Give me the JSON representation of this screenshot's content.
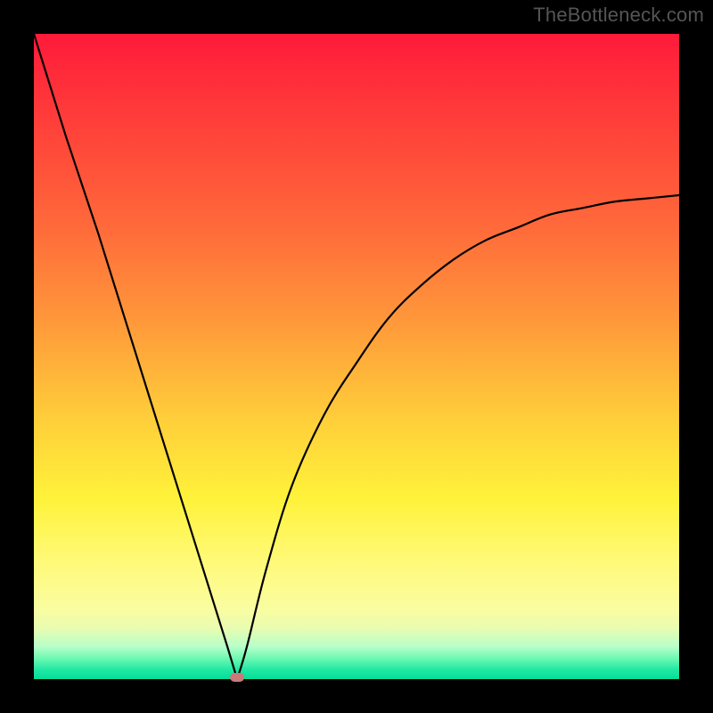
{
  "watermark": "TheBottleneck.com",
  "chart_data": {
    "type": "line",
    "title": "",
    "xlabel": "",
    "ylabel": "",
    "x": [
      0.0,
      0.05,
      0.1,
      0.15,
      0.2,
      0.25,
      0.3,
      0.315,
      0.33,
      0.36,
      0.4,
      0.45,
      0.5,
      0.55,
      0.6,
      0.65,
      0.7,
      0.75,
      0.8,
      0.85,
      0.9,
      0.95,
      1.0
    ],
    "values": [
      1.0,
      0.84,
      0.69,
      0.53,
      0.37,
      0.21,
      0.05,
      0.0,
      0.05,
      0.17,
      0.3,
      0.41,
      0.49,
      0.56,
      0.61,
      0.65,
      0.68,
      0.7,
      0.72,
      0.73,
      0.74,
      0.745,
      0.75
    ],
    "xlim": [
      0,
      1
    ],
    "ylim": [
      0,
      1
    ],
    "minimum_marker": {
      "x": 0.315,
      "y": 0.0
    },
    "background_gradient": {
      "direction": "top-to-bottom",
      "stops": [
        {
          "pos": 0.0,
          "color": "#ff1a3a"
        },
        {
          "pos": 0.5,
          "color": "#ffb03a"
        },
        {
          "pos": 0.8,
          "color": "#fff23a"
        },
        {
          "pos": 1.0,
          "color": "#04dc9a"
        }
      ]
    },
    "curve_color": "#000000",
    "notes": "Cusp-shaped curve. Left branch descends roughly linearly from top-left to the minimum near x≈0.315. Right branch rises with decreasing slope toward the top-right, asymptoting near y≈0.75."
  }
}
